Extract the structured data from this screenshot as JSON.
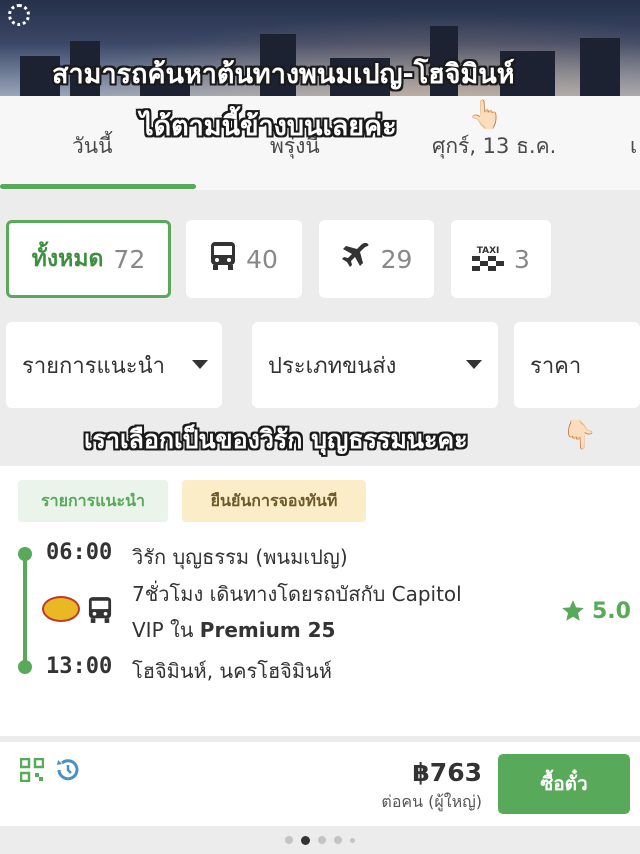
{
  "overlay": {
    "line1": "สามารถค้นหาต้นทางพนมเปญ-โฮจิมินห์",
    "line2": "ได้ตามนี้ข้างบนเลยค่ะ",
    "line3": "เราเลือกเป็นของวิรัก บุญธรรมนะคะ",
    "pointer1": "👆🏻",
    "pointer2": "👇🏻"
  },
  "date_tabs": [
    {
      "label": "วันนี้"
    },
    {
      "label": "พรุ่งนี้"
    },
    {
      "label": "ศุกร์, 13 ธ.ค."
    },
    {
      "label": "เ"
    }
  ],
  "filters": [
    {
      "label": "ทั้งหมด",
      "count": "72",
      "icon": "all"
    },
    {
      "label": "",
      "count": "40",
      "icon": "bus-icon"
    },
    {
      "label": "",
      "count": "29",
      "icon": "airplane-icon"
    },
    {
      "label": "",
      "count": "3",
      "icon": "taxi-icon"
    }
  ],
  "taxi_text": "TAXI",
  "dropdowns": [
    {
      "label": "รายการแนะนำ"
    },
    {
      "label": "ประเภทขนส่ง"
    },
    {
      "label": "ราคา"
    }
  ],
  "trip": {
    "tag_recommended": "รายการแนะนำ",
    "tag_instant": "ยืนยันการจองทันที",
    "depart_time": "06:00",
    "depart_place": "วิรัก บุญธรรม (พนมเปญ)",
    "desc_line1": "7ชั่วโมง เดินทางโดยรถบัสกับ Capitol",
    "desc_line2_prefix": "VIP ใน ",
    "desc_line2_bold": "Premium 25",
    "arrive_time": "13:00",
    "arrive_place": "โฮจิมินห์, นครโฮจิมินห์",
    "rating": "5.0"
  },
  "footer": {
    "price": "฿763",
    "price_note": "ต่อคน (ผู้ใหญ่)",
    "buy_label": "ซื้อตั๋ว"
  },
  "colors": {
    "accent": "#58a95a",
    "tag_yellow": "#fbedc8",
    "background": "#ececec"
  }
}
